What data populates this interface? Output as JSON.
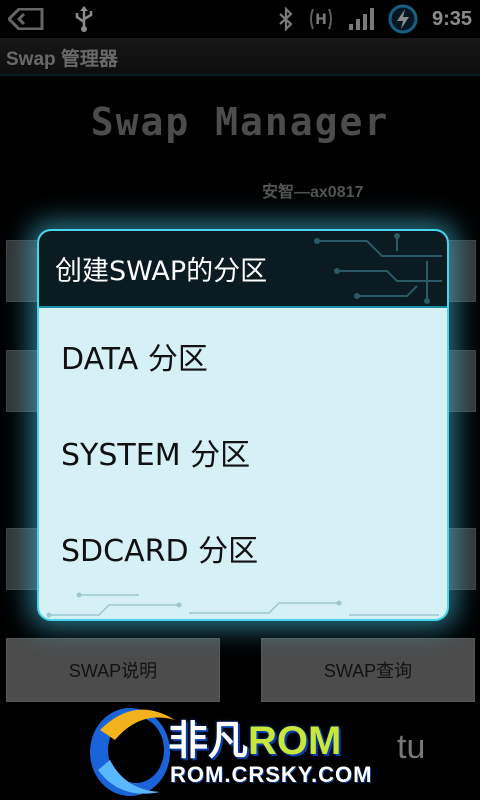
{
  "status_bar": {
    "time": "9:35",
    "icons": [
      "back-icon",
      "usb-icon",
      "bluetooth-icon",
      "hspa-icon",
      "signal-icon",
      "battery-charging-icon"
    ],
    "network_label": "H"
  },
  "app": {
    "title": "Swap 管理器",
    "logo_text": "Swap Manager",
    "author": "安智—ax0817"
  },
  "dialog": {
    "title": "创建SWAP的分区",
    "options": [
      {
        "label": "DATA 分区"
      },
      {
        "label": "SYSTEM 分区"
      },
      {
        "label": "SDCARD 分区"
      }
    ]
  },
  "buttons": {
    "swap_help": "SWAP说明",
    "swap_query": "SWAP查询"
  },
  "watermark": {
    "name_cn": "非凡",
    "name_rom": "ROM",
    "url": "ROM.CRSKY.COM",
    "extra": "tu"
  },
  "colors": {
    "dialog_accent": "#48d4ec",
    "dialog_body": "#d6f1f6",
    "dialog_header": "#0a1c22"
  }
}
